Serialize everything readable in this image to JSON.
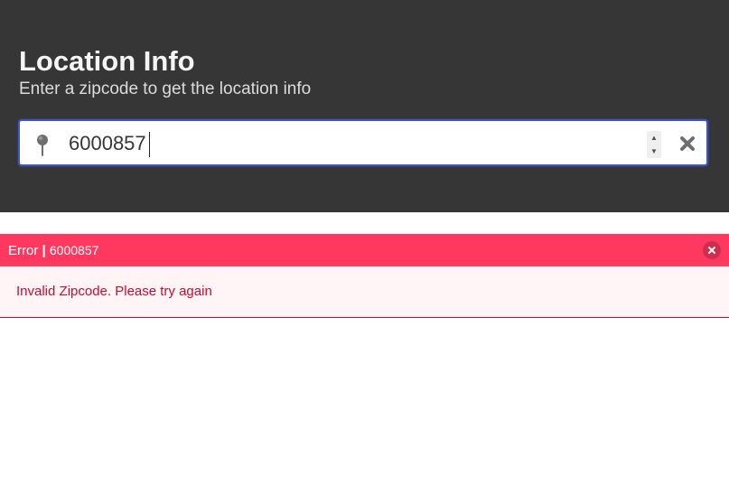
{
  "hero": {
    "title": "Location Info",
    "subtitle": "Enter a zipcode to get the location info"
  },
  "search": {
    "value": "6000857",
    "icon": "map-pin-icon",
    "clear_icon": "close-icon"
  },
  "error": {
    "label": "Error",
    "separator": "|",
    "zipcode": "6000857",
    "message": "Invalid Zipcode. Please try again"
  },
  "colors": {
    "hero_background": "#363636",
    "input_border": "#3e56c4",
    "error_header": "#ff3860",
    "error_body": "#fff5f7",
    "error_text": "#cd0930"
  }
}
